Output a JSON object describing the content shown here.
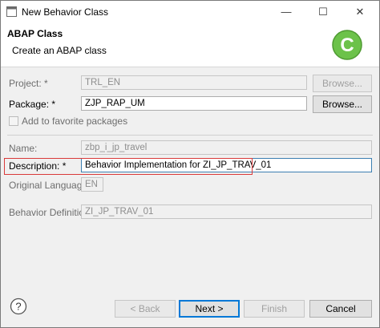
{
  "window": {
    "title": "New Behavior Class",
    "controls": {
      "minimize": "—",
      "maximize": "☐",
      "close": "✕"
    }
  },
  "banner": {
    "title": "ABAP Class",
    "description": "Create an ABAP class",
    "icon_letter": "C"
  },
  "form": {
    "project": {
      "label": "Project: *",
      "value": "TRL_EN",
      "button": "Browse..."
    },
    "package": {
      "label": "Package: *",
      "value": "ZJP_RAP_UM",
      "button": "Browse..."
    },
    "favorites": {
      "label": "Add to favorite packages",
      "checked": false
    },
    "name": {
      "label": "Name:",
      "value": "zbp_i_jp_travel"
    },
    "description": {
      "label": "Description: *",
      "value": "Behavior Implementation for ZI_JP_TRAV_01"
    },
    "language": {
      "label": "Original Language:",
      "value": "EN"
    },
    "behavior_definition": {
      "label": "Behavior Definition:",
      "value": "ZI_JP_TRAV_01"
    }
  },
  "footer": {
    "help": "?",
    "back": "< Back",
    "next": "Next >",
    "finish": "Finish",
    "cancel": "Cancel"
  },
  "colors": {
    "highlight": "#d93a3a",
    "icon_green": "#6cc24a",
    "focus_blue": "#0078d7"
  }
}
